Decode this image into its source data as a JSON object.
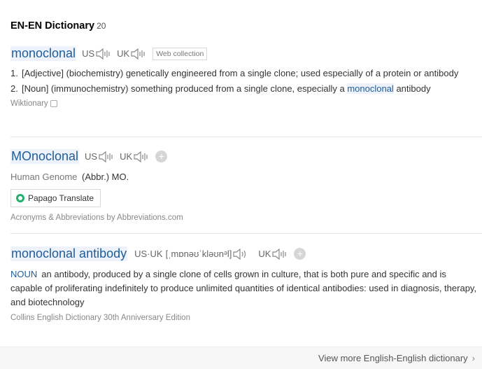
{
  "header": {
    "title": "EN-EN Dictionary",
    "count": "20"
  },
  "entries": [
    {
      "headword": "monoclonal",
      "us_label": "US",
      "uk_label": "UK",
      "badge": "Web collection",
      "definitions": [
        {
          "num": "1.",
          "text": "[Adjective] (biochemistry) genetically engineered from a single clone; used especially of a protein or antibody"
        },
        {
          "num": "2.",
          "text_before": "[Noun] (immunochemistry) something produced from a single clone, especially a ",
          "highlight": "monoclonal",
          "text_after": " antibody"
        }
      ],
      "source": "Wiktionary"
    },
    {
      "headword": "MOnoclonal",
      "us_label": "US",
      "uk_label": "UK",
      "plus": "+",
      "category": "Human Genome",
      "abbr": "(Abbr.) MO.",
      "translate_button": "Papago Translate",
      "source": "Acronyms & Abbreviations by Abbreviations.com"
    },
    {
      "headword": "monoclonal antibody",
      "us_uk_label": "US·UK",
      "ipa": "[ˌmɒnəʊˈkləʊnᵊl]",
      "uk_label": "UK",
      "plus": "+",
      "pos": "NOUN",
      "definition": "an antibody, produced by a single clone of cells grown in culture, that is both pure and specific and is capable of proliferating indefinitely to produce unlimited quantities of identical antibodies: used in diagnosis, therapy, and biotechnology",
      "source": "Collins English Dictionary 30th Anniversary Edition"
    }
  ],
  "footer": {
    "more_label": "View more English-English dictionary",
    "chevron": "›"
  },
  "icons": {
    "speaker": "speaker-icon",
    "plus": "plus-icon",
    "checkbox": "checkbox-icon",
    "papago": "papago-logo-icon"
  },
  "colors": {
    "link": "#1f5c99",
    "highlight_bg": "#eef3fb",
    "papago": "#20b26b"
  }
}
